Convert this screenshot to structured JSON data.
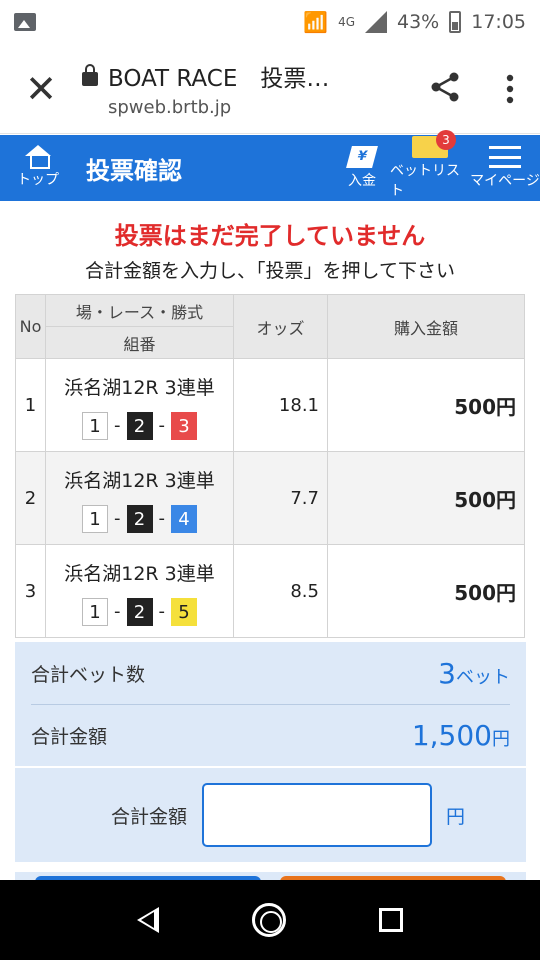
{
  "status_bar": {
    "network": "4G",
    "battery": "43%",
    "time": "17:05"
  },
  "browser": {
    "title": "BOAT RACE　投票…",
    "domain": "spweb.brtb.jp"
  },
  "header": {
    "home_label": "トップ",
    "title": "投票確認",
    "deposit_label": "入金",
    "deposit_icon_text": "¥",
    "betlist_label": "ベットリスト",
    "betlist_badge": "3",
    "mypage_label": "マイページ"
  },
  "messages": {
    "warning": "投票はまだ完了していません",
    "instruction": "合計金額を入力し、「投票」を押して下さい"
  },
  "table": {
    "headers": {
      "no": "No",
      "race": "場・レース・勝式",
      "combo": "組番",
      "odds": "オッズ",
      "amount": "購入金額"
    },
    "rows": [
      {
        "no": "1",
        "race": "浜名湖12R 3連単",
        "b1": "1",
        "b2": "2",
        "b3": "3",
        "odds": "18.1",
        "amount": "500円"
      },
      {
        "no": "2",
        "race": "浜名湖12R 3連単",
        "b1": "1",
        "b2": "2",
        "b3": "4",
        "odds": "7.7",
        "amount": "500円"
      },
      {
        "no": "3",
        "race": "浜名湖12R 3連単",
        "b1": "1",
        "b2": "2",
        "b3": "5",
        "odds": "8.5",
        "amount": "500円"
      }
    ],
    "separator": "-"
  },
  "summary": {
    "bet_count_label": "合計ベット数",
    "bet_count_value": "3",
    "bet_count_unit": "ベット",
    "total_label": "合計金額",
    "total_value": "1,500",
    "total_unit": "円"
  },
  "input": {
    "label": "合計金額",
    "value": "",
    "unit": "円"
  },
  "colors": {
    "header_blue": "#1e73d9",
    "warning_red": "#e12b2b",
    "boat_1": "#ffffff",
    "boat_2": "#222222",
    "boat_3": "#e84a4a",
    "boat_4": "#3a87e6",
    "boat_5": "#f5e03b"
  }
}
